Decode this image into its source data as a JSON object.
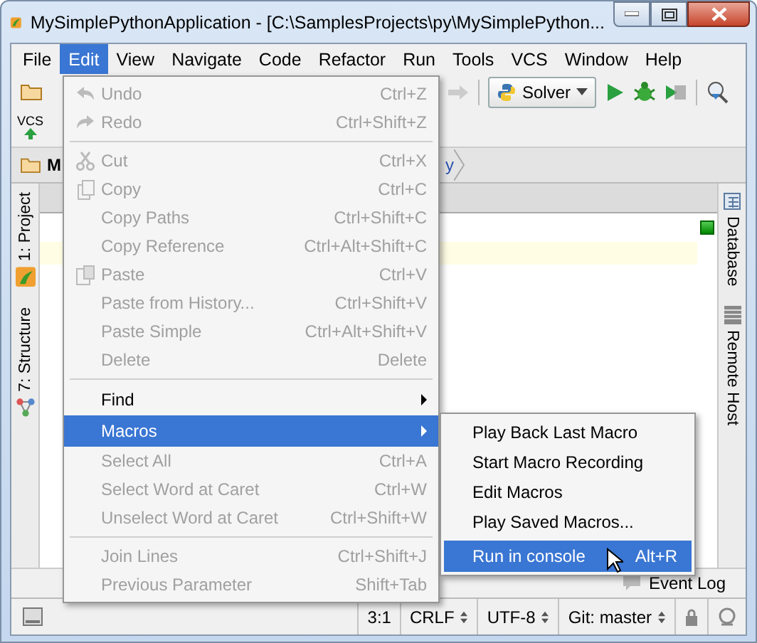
{
  "window": {
    "title": "MySimplePythonApplication - [C:\\SamplesProjects\\py\\MySimplePython..."
  },
  "menubar": [
    {
      "label": "File",
      "selected": false
    },
    {
      "label": "Edit",
      "selected": true
    },
    {
      "label": "View",
      "selected": false
    },
    {
      "label": "Navigate",
      "selected": false
    },
    {
      "label": "Code",
      "selected": false
    },
    {
      "label": "Refactor",
      "selected": false
    },
    {
      "label": "Run",
      "selected": false
    },
    {
      "label": "Tools",
      "selected": false
    },
    {
      "label": "VCS",
      "selected": false
    },
    {
      "label": "Window",
      "selected": false
    },
    {
      "label": "Help",
      "selected": false
    }
  ],
  "toolbar": {
    "run_configuration": "Solver",
    "vcs_label": "VCS"
  },
  "navbar": {
    "crumbs": [
      "M",
      "y"
    ]
  },
  "left_tool_tabs": [
    "1: Project",
    "7: Structure"
  ],
  "right_tool_tabs": [
    "Database",
    "Remote Host"
  ],
  "edit_menu": [
    {
      "kind": "item",
      "label": "Undo",
      "shortcut": "Ctrl+Z",
      "disabled": true,
      "selected": false
    },
    {
      "kind": "item",
      "label": "Redo",
      "shortcut": "Ctrl+Shift+Z",
      "disabled": true,
      "selected": false
    },
    {
      "kind": "separator"
    },
    {
      "kind": "item",
      "label": "Cut",
      "shortcut": "Ctrl+X",
      "disabled": true,
      "selected": false
    },
    {
      "kind": "item",
      "label": "Copy",
      "shortcut": "Ctrl+C",
      "disabled": true,
      "selected": false
    },
    {
      "kind": "item",
      "label": "Copy Paths",
      "shortcut": "Ctrl+Shift+C",
      "disabled": true,
      "selected": false
    },
    {
      "kind": "item",
      "label": "Copy Reference",
      "shortcut": "Ctrl+Alt+Shift+C",
      "disabled": true,
      "selected": false
    },
    {
      "kind": "item",
      "label": "Paste",
      "shortcut": "Ctrl+V",
      "disabled": true,
      "selected": false
    },
    {
      "kind": "item",
      "label": "Paste from History...",
      "shortcut": "Ctrl+Shift+V",
      "disabled": true,
      "selected": false
    },
    {
      "kind": "item",
      "label": "Paste Simple",
      "shortcut": "Ctrl+Alt+Shift+V",
      "disabled": true,
      "selected": false
    },
    {
      "kind": "item",
      "label": "Delete",
      "shortcut": "Delete",
      "disabled": true,
      "selected": false
    },
    {
      "kind": "separator"
    },
    {
      "kind": "submenu",
      "label": "Find",
      "disabled": false,
      "selected": false
    },
    {
      "kind": "submenu",
      "label": "Macros",
      "disabled": false,
      "selected": true
    },
    {
      "kind": "item",
      "label": "Select All",
      "shortcut": "Ctrl+A",
      "disabled": true,
      "selected": false
    },
    {
      "kind": "item",
      "label": "Select Word at Caret",
      "shortcut": "Ctrl+W",
      "disabled": true,
      "selected": false
    },
    {
      "kind": "item",
      "label": "Unselect Word at Caret",
      "shortcut": "Ctrl+Shift+W",
      "disabled": true,
      "selected": false
    },
    {
      "kind": "separator"
    },
    {
      "kind": "item",
      "label": "Join Lines",
      "shortcut": "Ctrl+Shift+J",
      "disabled": true,
      "selected": false
    },
    {
      "kind": "item",
      "label": "Previous Parameter",
      "shortcut": "Shift+Tab",
      "disabled": true,
      "selected": false
    }
  ],
  "macros_menu": [
    {
      "label": "Play Back Last Macro",
      "selected": false
    },
    {
      "label": "Start Macro Recording",
      "selected": false
    },
    {
      "label": "Edit Macros",
      "selected": false
    },
    {
      "label": "Play Saved Macros...",
      "selected": false
    },
    {
      "label": "Run in console",
      "shortcut": "Alt+R",
      "selected": true
    }
  ],
  "tool_window_bar": {
    "event_log": "Event Log"
  },
  "status_bar": {
    "position": "3:1",
    "line_separator": "CRLF",
    "encoding": "UTF-8",
    "vcs_branch": "Git: master"
  }
}
